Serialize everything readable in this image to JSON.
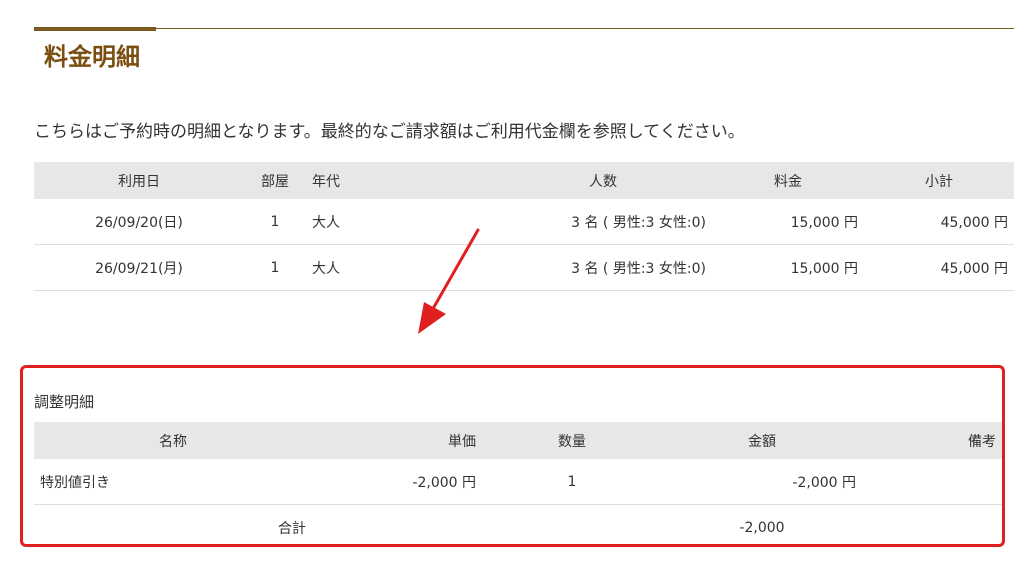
{
  "page_title": "料金明細",
  "intro": "こちらはご予約時の明細となります。最終的なご請求額はご利用代金欄を参照してください。",
  "fees_table": {
    "headers": [
      "利用日",
      "部屋",
      "年代",
      "人数",
      "料金",
      "小計"
    ],
    "rows": [
      [
        "26/09/20(日)",
        "1",
        "大人",
        "3 名 ( 男性:3 女性:0)",
        "15,000 円",
        "45,000 円"
      ],
      [
        "26/09/21(月)",
        "1",
        "大人",
        "3 名 ( 男性:3 女性:0)",
        "15,000 円",
        "45,000 円"
      ]
    ]
  },
  "adjustment": {
    "title": "調整明細",
    "headers": [
      "名称",
      "単価",
      "数量",
      "金額",
      "備考"
    ],
    "rows": [
      [
        "特別値引き",
        "-2,000 円",
        "1",
        "-2,000 円",
        ""
      ]
    ],
    "total_label": "合計",
    "total_value": "-2,000"
  },
  "colors": {
    "accent": "#7a5a1e",
    "highlight": "#e02020",
    "header_bg": "#e7e7e7"
  }
}
